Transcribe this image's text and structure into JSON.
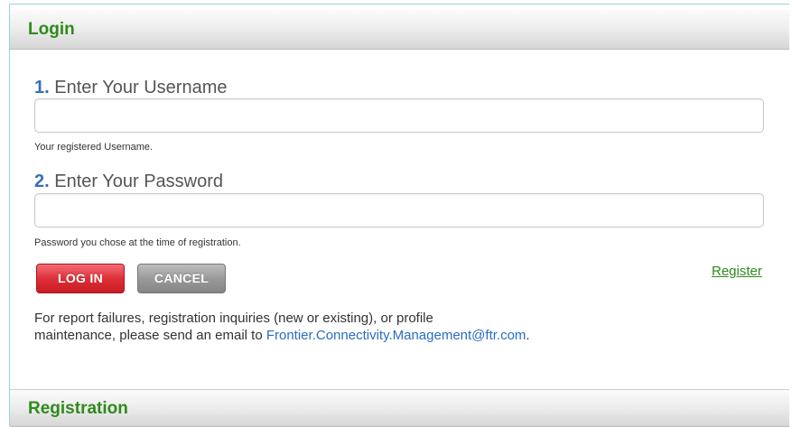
{
  "login_panel": {
    "title": "Login",
    "username": {
      "step_number": "1.",
      "label": "Enter Your Username",
      "value": "",
      "hint": "Your registered Username."
    },
    "password": {
      "step_number": "2.",
      "label": "Enter Your Password",
      "value": "",
      "hint": "Password you chose at the time of registration."
    },
    "buttons": {
      "login_label": "LOG IN",
      "cancel_label": "CANCEL"
    },
    "register_link": "Register",
    "info": {
      "line1": "For report failures, registration inquiries (new or existing), or profile",
      "line2_prefix": "maintenance, please send an email to ",
      "email": "Frontier.Connectivity.Management@ftr.com",
      "line2_suffix": "."
    }
  },
  "registration_panel": {
    "title": "Registration"
  },
  "colors": {
    "header_title": "#2f8a1c",
    "step_number": "#3a6eb8",
    "login_button": "#de3039",
    "cancel_button": "#9a9a9a",
    "link": "#2a6cc4",
    "frame_border": "#8fd3e8"
  }
}
